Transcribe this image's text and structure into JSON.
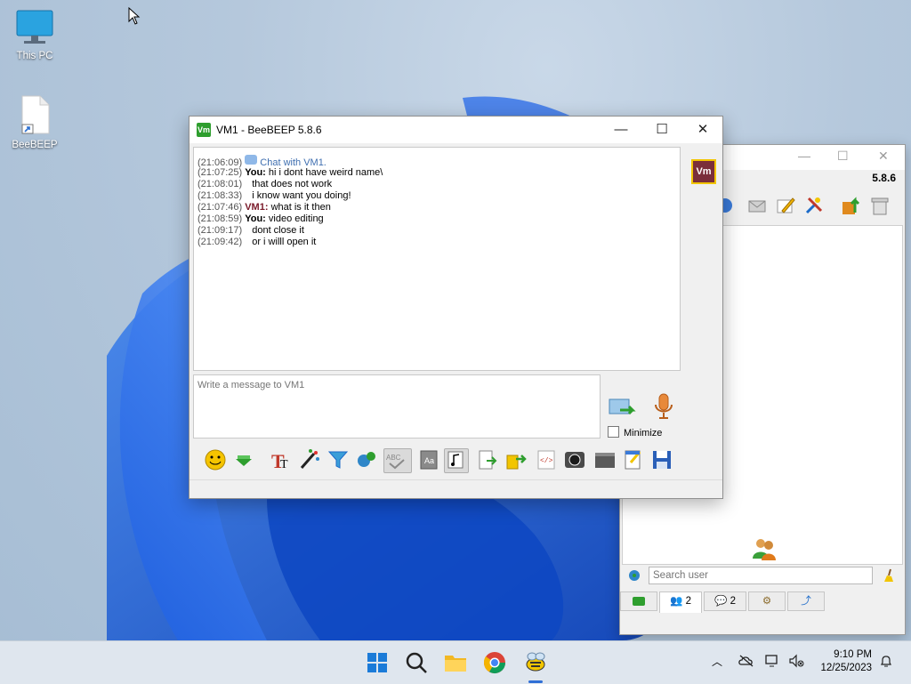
{
  "desktop": {
    "icons": [
      {
        "label": "This PC",
        "icon": "monitor-icon"
      },
      {
        "label": "BeeBEEP",
        "icon": "file-shortcut-icon"
      }
    ]
  },
  "main_window": {
    "version": "5.8.6",
    "search": {
      "placeholder": "Search user",
      "value": ""
    },
    "tabs": [
      {
        "label": "",
        "icon": "chat-green-icon"
      },
      {
        "label": "2",
        "icon": "users-icon"
      },
      {
        "label": "2",
        "icon": "chats-icon"
      },
      {
        "label": "",
        "icon": "groups-icon"
      },
      {
        "label": "",
        "icon": "share-icon"
      }
    ]
  },
  "chat_window": {
    "title": "VM1 - BeeBEEP 5.8.6",
    "app_icon_text": "Vm",
    "badge": "Vm",
    "messages": [
      {
        "time": "(21:06:09)",
        "sender": "",
        "text": "Chat with VM1.",
        "kind": "system"
      },
      {
        "time": "(21:07:25)",
        "sender": "You:",
        "text": "hi i dont have weird name\\",
        "kind": "you"
      },
      {
        "time": "(21:08:01)",
        "sender": "",
        "text": "that does not work",
        "kind": "cont"
      },
      {
        "time": "(21:08:33)",
        "sender": "",
        "text": "i know want you doing!",
        "kind": "cont"
      },
      {
        "time": "(21:07:46)",
        "sender": "VM1:",
        "text": "what is it then",
        "kind": "vm"
      },
      {
        "time": "(21:08:59)",
        "sender": "You:",
        "text": "video editing",
        "kind": "you"
      },
      {
        "time": "(21:09:17)",
        "sender": "",
        "text": "dont close it",
        "kind": "cont"
      },
      {
        "time": "(21:09:42)",
        "sender": "",
        "text": "or i willl open it",
        "kind": "cont"
      }
    ],
    "input": {
      "placeholder": "Write a message to VM1",
      "value": ""
    },
    "minimize_label": "Minimize"
  },
  "taskbar": {
    "time": "9:10 PM",
    "date": "12/25/2023"
  }
}
